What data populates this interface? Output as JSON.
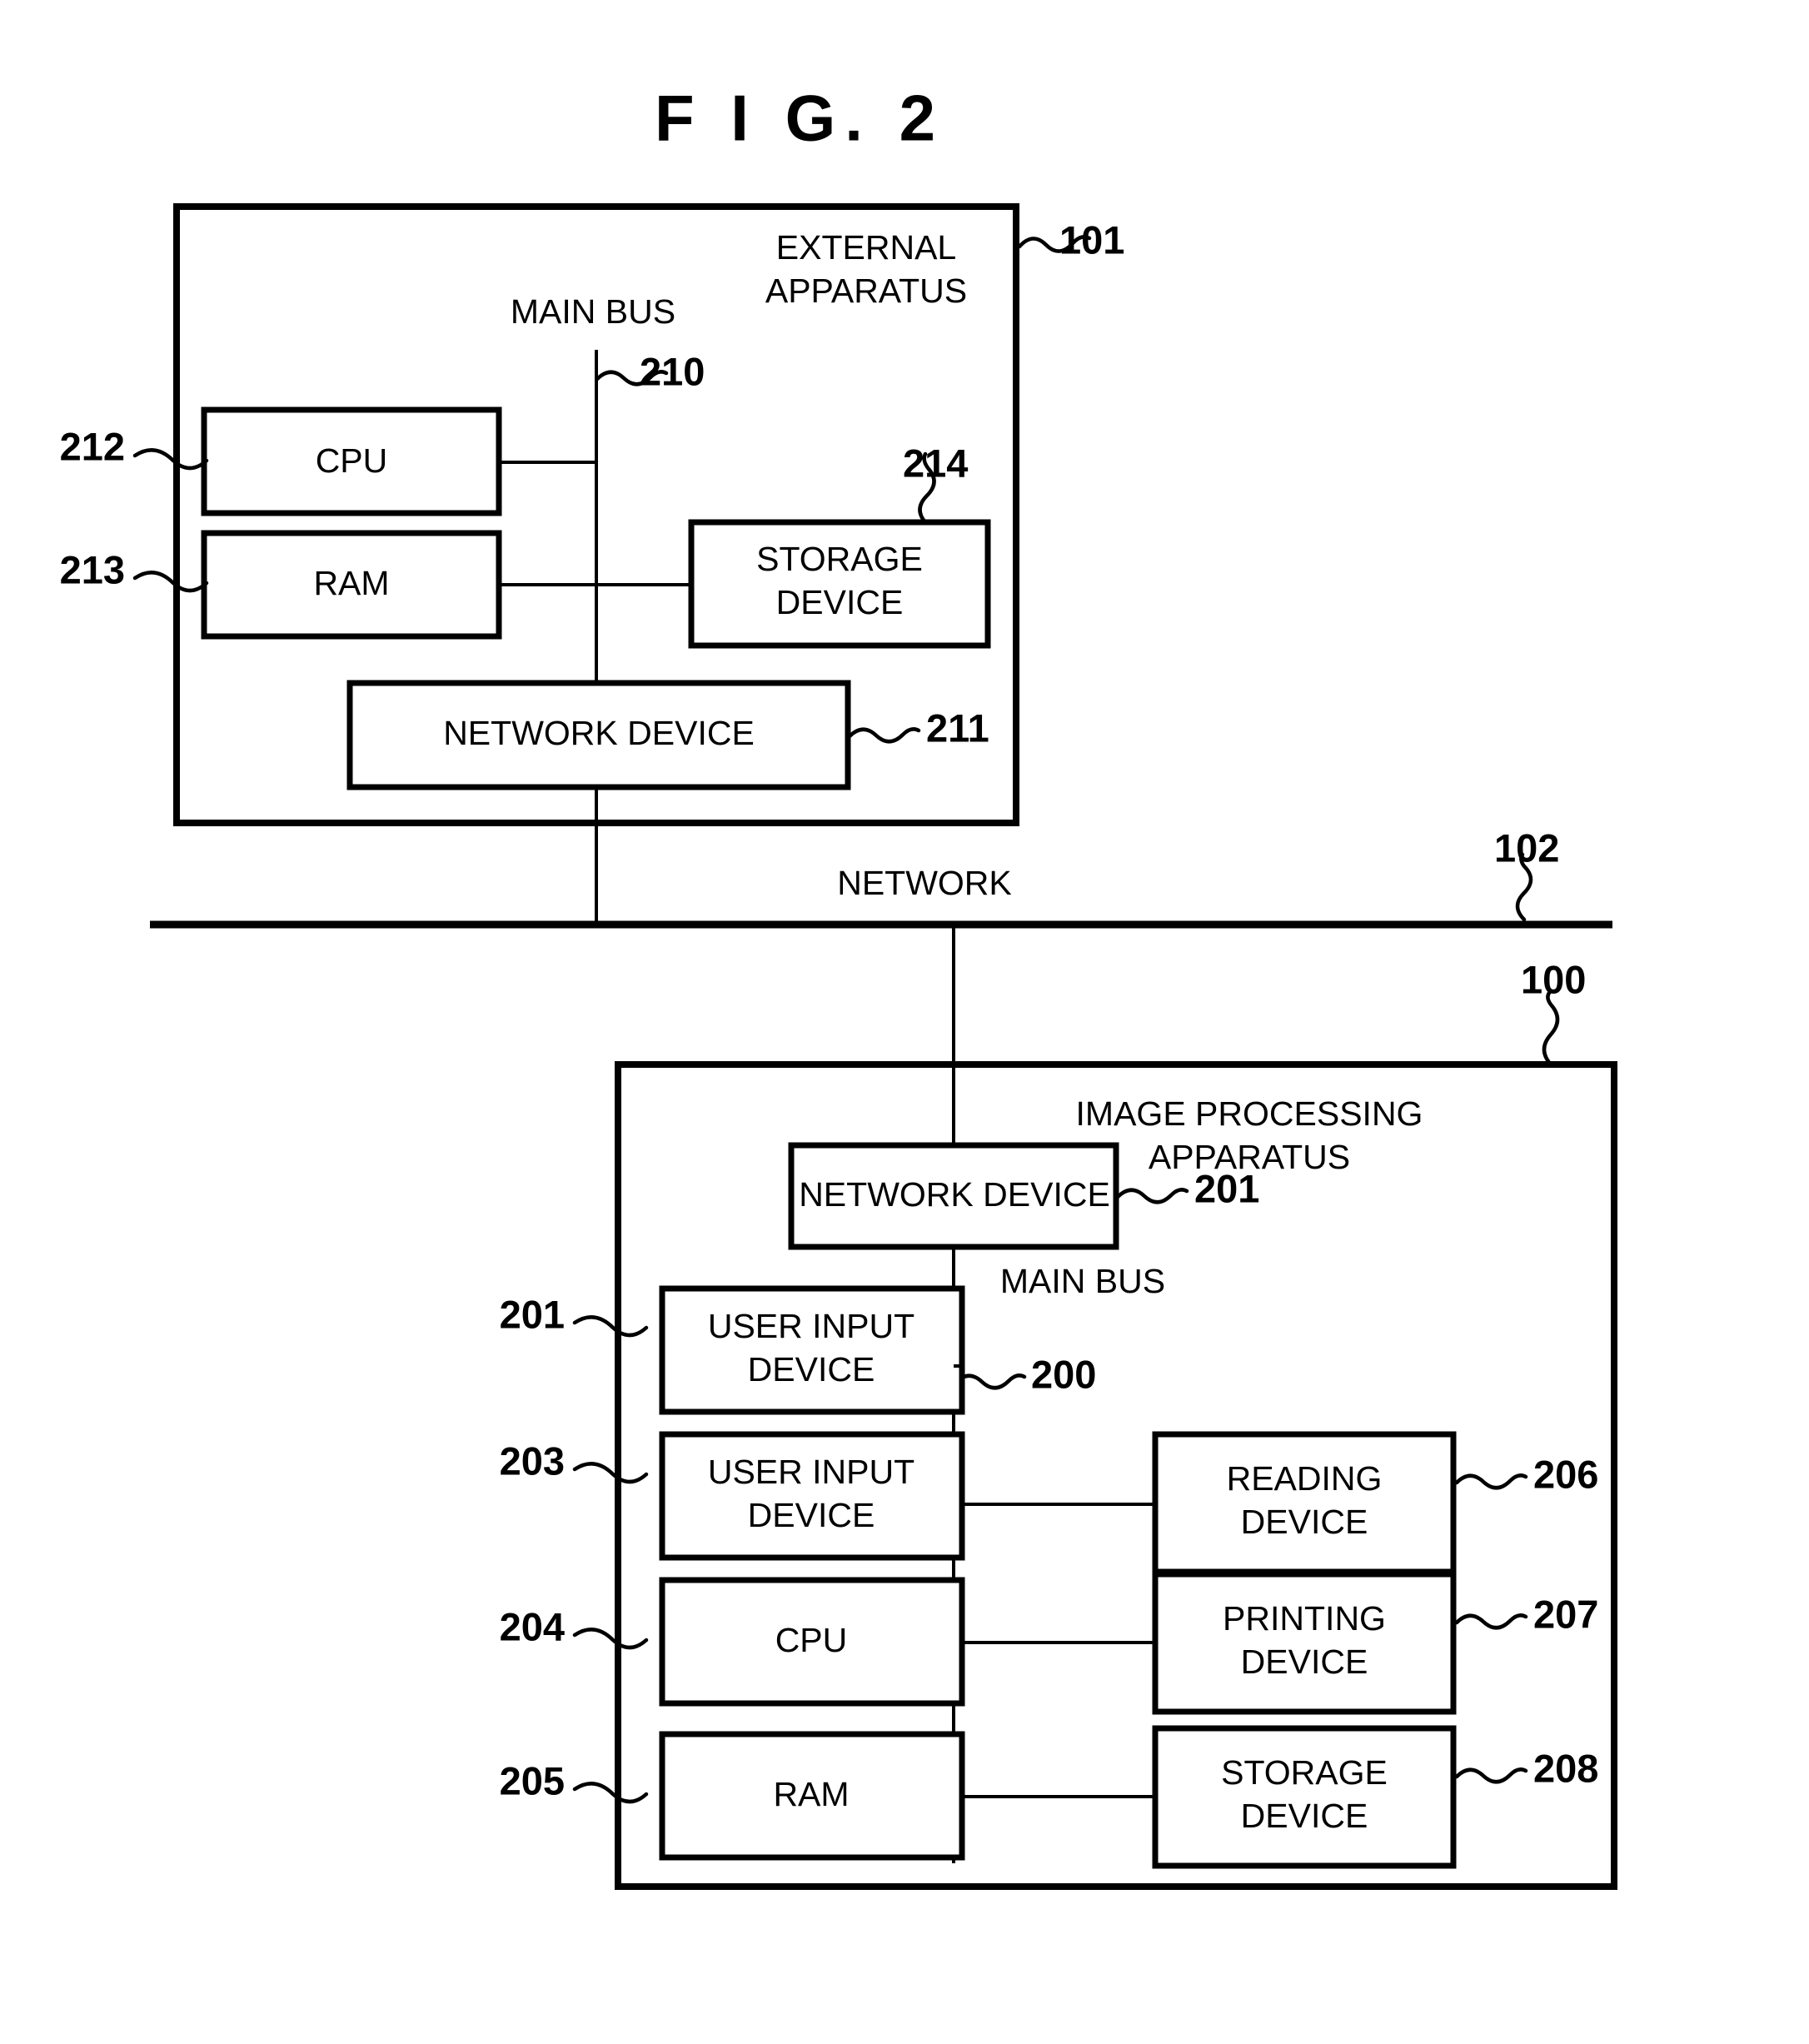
{
  "figure": {
    "title": "F I G.  2",
    "type": "block-diagram"
  },
  "top_apparatus": {
    "name": "EXTERNAL APPARATUS",
    "name_line1": "EXTERNAL",
    "name_line2": "APPARATUS",
    "ref": "101",
    "bus_label": "MAIN BUS",
    "bus_ref": "210",
    "blocks": [
      {
        "label": "CPU",
        "ref": "212"
      },
      {
        "label": "RAM",
        "ref": "213"
      },
      {
        "label_line1": "STORAGE",
        "label_line2": "DEVICE",
        "label": "STORAGE DEVICE",
        "ref": "214"
      },
      {
        "label": "NETWORK DEVICE",
        "ref": "211"
      }
    ]
  },
  "network": {
    "label": "NETWORK",
    "ref": "102"
  },
  "bottom_apparatus": {
    "name": "IMAGE PROCESSING APPARATUS",
    "name_line1": "IMAGE PROCESSING",
    "name_line2": "APPARATUS",
    "ref": "100",
    "bus_label": "MAIN BUS",
    "bus_ref": "200",
    "blocks": [
      {
        "label": "NETWORK DEVICE",
        "ref": "201"
      },
      {
        "label_line1": "USER INPUT",
        "label_line2": "DEVICE",
        "label": "USER INPUT DEVICE",
        "ref": "201"
      },
      {
        "label_line1": "USER INPUT",
        "label_line2": "DEVICE",
        "label": "USER INPUT DEVICE",
        "ref": "203"
      },
      {
        "label": "CPU",
        "ref": "204"
      },
      {
        "label": "RAM",
        "ref": "205"
      },
      {
        "label_line1": "READING",
        "label_line2": "DEVICE",
        "label": "READING DEVICE",
        "ref": "206"
      },
      {
        "label_line1": "PRINTING",
        "label_line2": "DEVICE",
        "label": "PRINTING DEVICE",
        "ref": "207"
      },
      {
        "label_line1": "STORAGE",
        "label_line2": "DEVICE",
        "label": "STORAGE DEVICE",
        "ref": "208"
      }
    ]
  },
  "colors": {
    "ink": "#000000",
    "paper": "#ffffff"
  }
}
